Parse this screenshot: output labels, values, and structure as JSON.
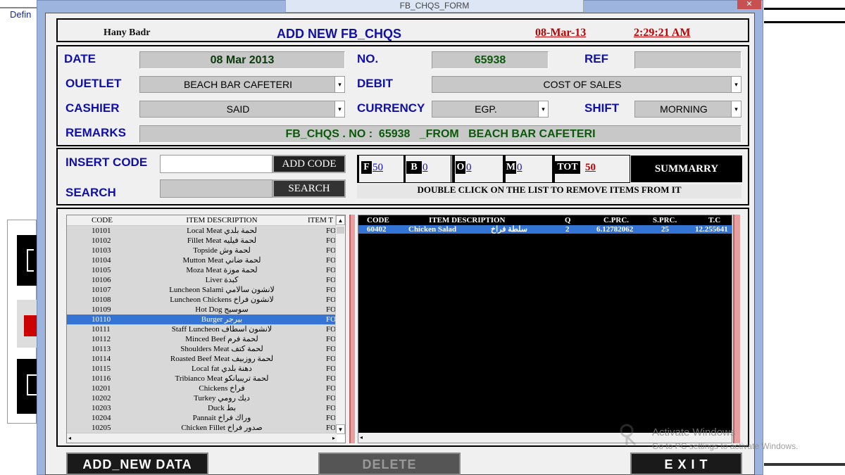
{
  "background_app": {
    "title": "Defin"
  },
  "window": {
    "title": "FB_CHQS_FORM",
    "close": "✕"
  },
  "header": {
    "user": "Hany Badr",
    "form_title": "ADD NEW FB_CHQS",
    "date": "08-Mar-13",
    "time": "2:29:21 AM"
  },
  "fields": {
    "date_label": "DATE",
    "date_value": "08 Mar 2013",
    "no_label": "NO.",
    "no_value": "65938",
    "ref_label": "REF",
    "ref_value": "",
    "outlet_label": "OUETLET",
    "outlet_value": "BEACH BAR CAFETERI",
    "debit_label": "DEBIT",
    "debit_value": "COST OF SALES",
    "cashier_label": "CASHIER",
    "cashier_value": "SAID",
    "currency_label": "CURRENCY",
    "currency_value": "EGP.",
    "shift_label": "SHIFT",
    "shift_value": "MORNING",
    "remarks_label": "REMARKS",
    "remarks_value": "FB_CHQS . NO :  65938   _FROM   BEACH BAR CAFETERI"
  },
  "insert": {
    "code_label": "INSERT CODE",
    "add_code": "ADD CODE",
    "search_label": "SEARCH",
    "search_btn": "SEARCH"
  },
  "summary": {
    "f_label": "F",
    "f_value": "50",
    "b_label": "B",
    "b_value": "0",
    "o_label": "O",
    "o_value": "0",
    "m_label": "M",
    "m_value": "0",
    "tot_label": "TOT",
    "tot_value": "50",
    "summary_btn": "SUMMARRY",
    "hint": "DOUBLE CLICK ON THE LIST TO REMOVE ITEMS FROM IT"
  },
  "items_list": {
    "headers": [
      "CODE",
      "ITEM DESCRIPTION",
      "ITEM T"
    ],
    "rows": [
      [
        "10101",
        "Local Meat لحمة بلدي",
        "FO"
      ],
      [
        "10102",
        "Fillet Meat لحمة فيليه",
        "FO"
      ],
      [
        "10103",
        "Topside لحمة وش",
        "FO"
      ],
      [
        "10104",
        "Mutton Meat لحمة ضاني",
        "FO"
      ],
      [
        "10105",
        "Moza Meat لحمة موزة",
        "FO"
      ],
      [
        "10106",
        "Liver كبدة",
        "FO"
      ],
      [
        "10107",
        "Luncheon Salami لانشون سالامي",
        "FO"
      ],
      [
        "10108",
        "Luncheon Chickens لانشون فراخ",
        "FO"
      ],
      [
        "10109",
        "Hot Dog سوسيج",
        "FO"
      ],
      [
        "10110",
        "Burger بيرجر",
        "FO"
      ],
      [
        "10111",
        "Staff Luncheon لانشون اسطاف",
        "FO"
      ],
      [
        "10112",
        "Minced Beef لحمة فرم",
        "FO"
      ],
      [
        "10113",
        "Shoulders Meat لحمة كتف",
        "FO"
      ],
      [
        "10114",
        "Roasted Beef Meat لحمة روزبيف",
        "FO"
      ],
      [
        "10115",
        "Local fat دهنة بلدي",
        "FO"
      ],
      [
        "10116",
        "Tribianco Meat لحمة تريبيانكو",
        "FO"
      ],
      [
        "10201",
        "Chickens فراخ",
        "FO"
      ],
      [
        "10202",
        "Turkey ديك رومي",
        "FO"
      ],
      [
        "10203",
        "Duck بط",
        "FO"
      ],
      [
        "10204",
        "Pannait وراك فراخ",
        "FO"
      ],
      [
        "10205",
        "Chicken Fillet صدور فراخ",
        "FO"
      ]
    ],
    "selected_index": 9
  },
  "selected_list": {
    "headers": [
      "CODE",
      "ITEM DESCRIPTION",
      "Q",
      "C.PRC.",
      "S.PRC.",
      "T.C"
    ],
    "rows": [
      [
        "60402",
        "Chicken Salad",
        "سلطة فراخ",
        "2",
        "6.12782062",
        "25",
        "12.255641"
      ]
    ]
  },
  "actions": {
    "add_new": "ADD_NEW DATA",
    "delete": "DELETE",
    "exit": "E X I T"
  },
  "watermark": {
    "line1": "Activate Windows",
    "line2": "Go to PC settings to activate Windows."
  },
  "colors": {
    "label_blue": "#1010a8",
    "green_text": "#0a5a0a",
    "red_text": "#c00000",
    "selection": "#3474d4"
  }
}
